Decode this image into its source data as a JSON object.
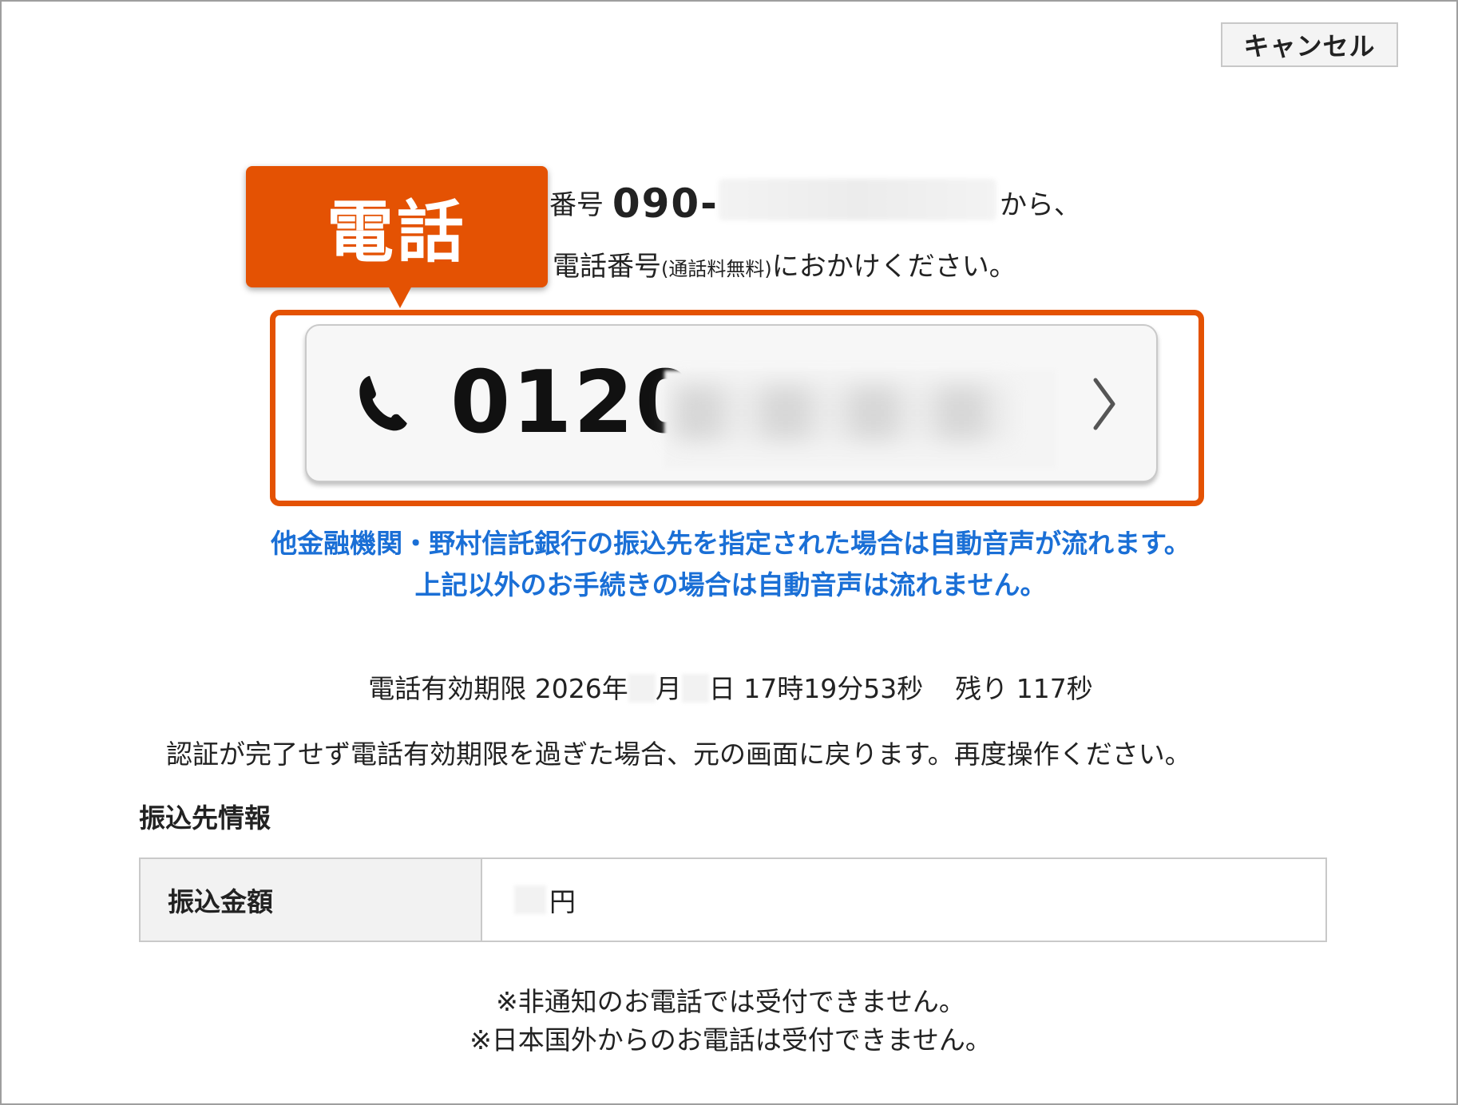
{
  "header": {
    "cancel_label": "キャンセル"
  },
  "callout": {
    "label": "電話"
  },
  "instructions": {
    "line1_prefix": "番号 ",
    "from_number": "090-",
    "line1_suffix": "から、",
    "line2_main": "電話番号",
    "line2_small": "(通話料無料)",
    "line2_suffix": "にお­かけください。"
  },
  "phone_button": {
    "number_visible": "0120-",
    "icon": "phone-icon",
    "chevron": "chevron-right-icon"
  },
  "notes": {
    "blue_line1": "他金融機関・野村信託銀行の振込先を指定された場合は自動音声が流れます。",
    "blue_line2": "上記以外のお手続きの場合は自動音声は流れません。"
  },
  "expiry": {
    "label": "電話有効期限 2026年",
    "month_suffix": "月",
    "day_suffix": "日 17時19分53秒",
    "remaining": "残り 117秒"
  },
  "auth_note": "認証が完了せず電話有効期限を過ぎた場合、元の画面に戻ります。再度操作ください。",
  "transfer_info": {
    "section_title": "振込先情報",
    "row_label": "振込金額",
    "amount_suffix": "円"
  },
  "footnotes": {
    "line1": "※非通知のお電話では受付できません。",
    "line2": "※日本国外からのお電話は受付できません。"
  },
  "colors": {
    "accent_orange": "#e45203",
    "note_blue": "#1a6fd6"
  }
}
